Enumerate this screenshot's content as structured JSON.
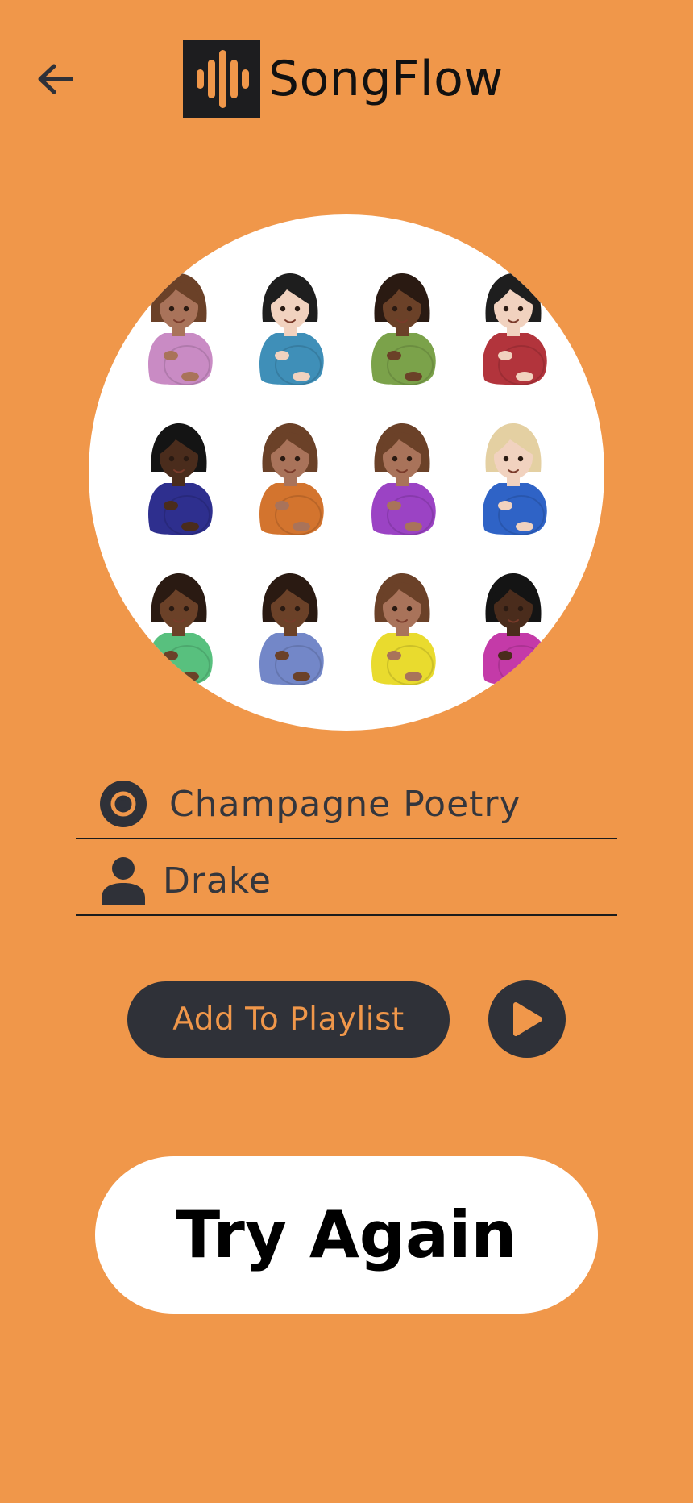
{
  "app": {
    "name": "SongFlow",
    "logo_icon": "sound-wave-icon",
    "back_icon": "arrow-left-icon"
  },
  "cover": {
    "description_icon": "pregnant-person-emoji-pattern",
    "background": "#FFFFFF",
    "figures": [
      {
        "skin": "#A9735A",
        "hair": "#6B4128",
        "shirt": "#C98BC4"
      },
      {
        "skin": "#F1D2BF",
        "hair": "#1E1E1E",
        "shirt": "#3F8FB8"
      },
      {
        "skin": "#6B4128",
        "hair": "#2A1A12",
        "shirt": "#7BA24A"
      },
      {
        "skin": "#F1D2BF",
        "hair": "#1E1E1E",
        "shirt": "#B2343C"
      },
      {
        "skin": "#4A2C1C",
        "hair": "#141414",
        "shirt": "#2E2F8E"
      },
      {
        "skin": "#A9735A",
        "hair": "#6B4128",
        "shirt": "#D3742E"
      },
      {
        "skin": "#A9735A",
        "hair": "#6B4128",
        "shirt": "#9B43C4"
      },
      {
        "skin": "#F1D2BF",
        "hair": "#E4D0A2",
        "shirt": "#2F63C6"
      },
      {
        "skin": "#6B4128",
        "hair": "#2A1A12",
        "shirt": "#58C07E"
      },
      {
        "skin": "#6B4128",
        "hair": "#2A1A12",
        "shirt": "#7387C8"
      },
      {
        "skin": "#A9735A",
        "hair": "#6B4128",
        "shirt": "#E9DB2E"
      },
      {
        "skin": "#4A2C1C",
        "hair": "#141414",
        "shirt": "#C43AA8"
      }
    ]
  },
  "song": {
    "icon": "disc-icon",
    "title": "Champagne Poetry"
  },
  "artist": {
    "icon": "person-icon",
    "name": "Drake"
  },
  "actions": {
    "add_to_playlist": "Add To Playlist",
    "play_icon": "play-icon",
    "try_again": "Try Again"
  },
  "colors": {
    "background": "#F0974A",
    "dark": "#2F3138",
    "white": "#FFFFFF"
  }
}
